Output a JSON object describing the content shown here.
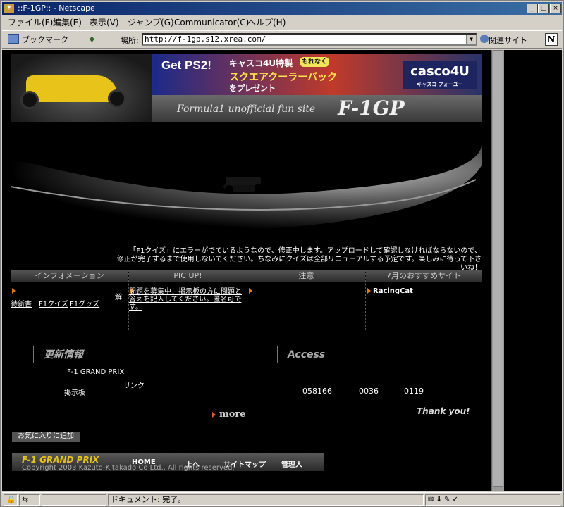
{
  "window": {
    "title": "::F-1GP:: - Netscape",
    "menu": [
      "ファイル(F)",
      "編集(E)",
      "表示(V)",
      "ジャンプ(G)",
      "Communicator(C)",
      "ヘルプ(H)"
    ]
  },
  "navbar": {
    "bookmarks": "ブックマーク",
    "location_label": "場所:",
    "url": "http://f-1gp.s12.xrea.com/",
    "related": "関連サイト",
    "netscape_logo": "N"
  },
  "header": {
    "banner_lead": "Get PS2!",
    "banner_line1": "キャスコ4U特製",
    "banner_badge": "もれなく",
    "banner_line2": "スクエアクーラーバック",
    "banner_line3": "をプレゼント",
    "banner_brand": "casco4U",
    "banner_brand_sub": "キャスコ フォーユー",
    "tagline": "Formula1 unofficial fun site",
    "site_title": "F-1GP"
  },
  "notice": {
    "line1": "「F1クイズ」にエラーがでているようなので、修正中します。アップロードして確認しなければならないので、",
    "line2": "修正が完了するまで使用しないでください。ちなみにクイズは全部リニューアルする予定です。楽しみに待って下さいね！"
  },
  "tabs": [
    {
      "title": "インフォメーション"
    },
    {
      "title": "PIC UP!"
    },
    {
      "title": "注意"
    },
    {
      "title": "7月のおすすめサイト"
    }
  ],
  "info": {
    "links": [
      "待新書",
      "F1クイズ",
      "F1グッズ"
    ],
    "aside": "解"
  },
  "picup": {
    "text": "問題を募集中！掲示板の方に問題と答えを記入してください。匿名可です。"
  },
  "recommend": {
    "site": "RacingCat"
  },
  "updates": {
    "heading": "更新情報",
    "items": [
      "F-1 GRAND PRIX",
      "リンク",
      "掲示板"
    ],
    "more": "more"
  },
  "access": {
    "heading": "Access",
    "counts": [
      "058166",
      "0036",
      "0119"
    ],
    "thanks": "Thank you!"
  },
  "favorite_button": "お気に入りに追加",
  "footer": {
    "title": "F-1 GRAND PRIX",
    "nav": [
      "HOME",
      "上へ",
      "サイトマップ",
      "管理人"
    ],
    "copyright": "Copyright 2003 Kazuto-Kitakado Co Ltd., All rights reserved."
  },
  "status": {
    "text": "ドキュメント: 完了。"
  }
}
